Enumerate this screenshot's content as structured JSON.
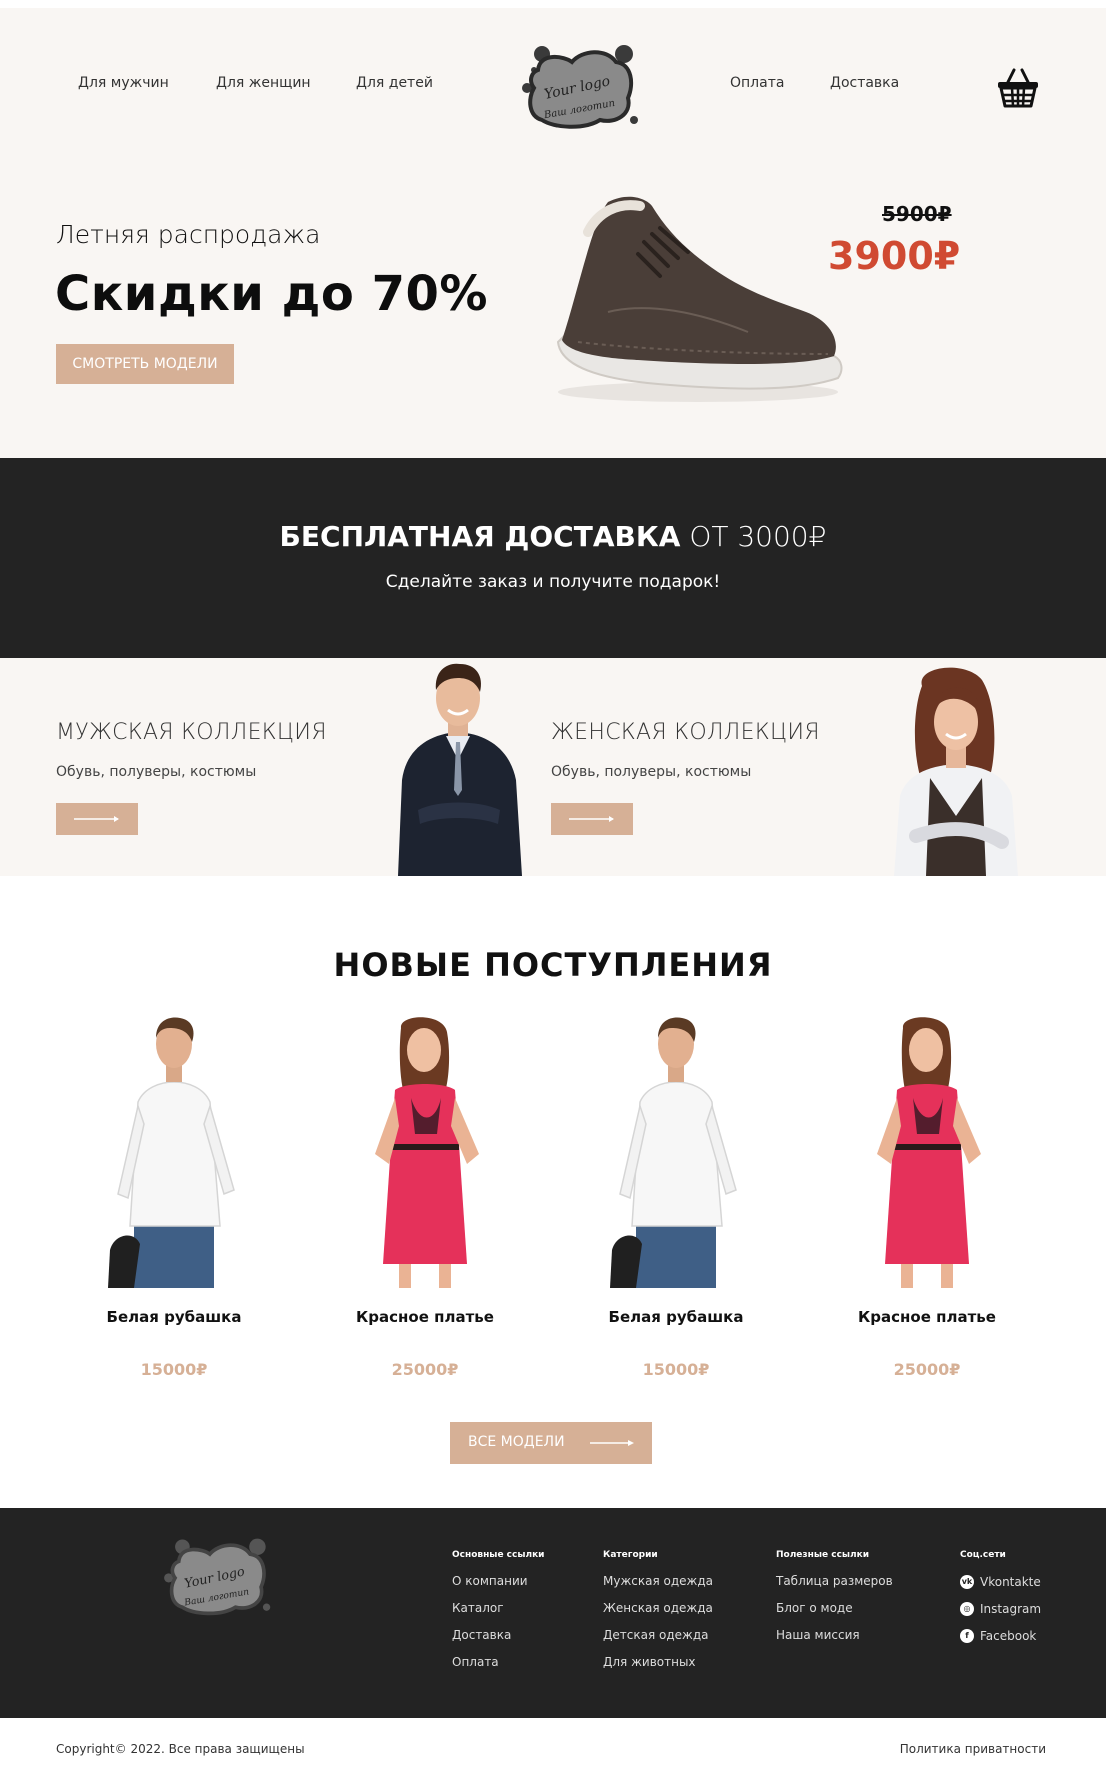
{
  "nav": {
    "left": [
      "Для мужчин",
      "Для женщин",
      "Для детей"
    ],
    "right": [
      "Оплата",
      "Доставка"
    ],
    "cart_icon": "basket-icon"
  },
  "logo": {
    "line1": "Your logo",
    "line2": "Ваш логотип"
  },
  "hero": {
    "subtitle": "Летняя распродажа",
    "title": "Скидки до 70%",
    "button": "СМОТРЕТЬ МОДЕЛИ",
    "old_price": "5900₽",
    "new_price": "3900₽"
  },
  "promo": {
    "title_bold": "БЕСПЛАТНАЯ ДОСТАВКА",
    "title_light": "ОТ 3000₽",
    "subtitle": "Сделайте заказ и получите подарок!"
  },
  "collections": [
    {
      "title": "МУЖСКАЯ КОЛЛЕКЦИЯ",
      "subtitle": "Обувь, полуверы, костюмы"
    },
    {
      "title": "ЖЕНСКАЯ КОЛЛЕКЦИЯ",
      "subtitle": "Обувь, полуверы, костюмы"
    }
  ],
  "arrivals": {
    "title": "НОВЫЕ ПОСТУПЛЕНИЯ",
    "products": [
      {
        "name": "Белая рубашка",
        "price": "15000₽"
      },
      {
        "name": "Красное платье",
        "price": "25000₽"
      },
      {
        "name": "Белая рубашка",
        "price": "15000₽"
      },
      {
        "name": "Красное платье",
        "price": "25000₽"
      }
    ],
    "all_button": "ВСЕ МОДЕЛИ"
  },
  "footer": {
    "columns": [
      {
        "heading": "Основные ссылки",
        "links": [
          "О компании",
          "Каталог",
          "Доставка",
          "Оплата"
        ]
      },
      {
        "heading": "Категории",
        "links": [
          "Мужская одежда",
          "Женская одежда",
          "Детская одежда",
          "Для животных"
        ]
      },
      {
        "heading": "Полезные ссылки",
        "links": [
          "Таблица размеров",
          "Блог о моде",
          "Наша миссия"
        ]
      }
    ],
    "social": {
      "heading": "Соц.сети",
      "links": [
        {
          "label": "Vkontakte",
          "icon": "vk-icon",
          "glyph": "vk"
        },
        {
          "label": "Instagram",
          "icon": "instagram-icon",
          "glyph": "◎"
        },
        {
          "label": "Facebook",
          "icon": "facebook-icon",
          "glyph": "f"
        }
      ]
    },
    "copyright": "Copyright© 2022. Все права защищены",
    "privacy": "Политика приватности"
  },
  "colors": {
    "accent": "#d6b096",
    "sale": "#d04a32",
    "dark": "#232323",
    "hero_bg": "#f9f6f3"
  }
}
